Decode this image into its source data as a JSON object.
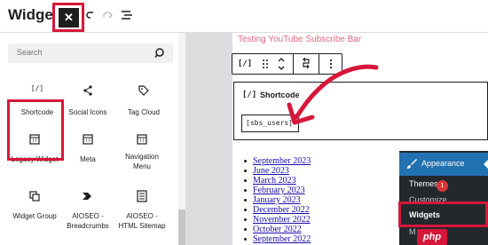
{
  "header": {
    "title": "Widgets",
    "close_glyph": "✕",
    "icons": [
      "close-icon",
      "undo-icon",
      "redo-icon",
      "list-view-icon"
    ]
  },
  "inserter": {
    "search_placeholder": "Search",
    "blocks": [
      {
        "label": "Shortcode",
        "icon": "shortcode-icon",
        "glyph": "[/]"
      },
      {
        "label": "Social Icons",
        "icon": "share-icon"
      },
      {
        "label": "Tag Cloud",
        "icon": "tag-icon"
      },
      {
        "label": "Legacy Widget",
        "icon": "calendar-icon"
      },
      {
        "label": "Meta",
        "icon": "calendar-icon"
      },
      {
        "label": "Navigation Menu",
        "icon": "calendar-icon"
      },
      {
        "label": "Widget Group",
        "icon": "group-icon"
      },
      {
        "label": "AIOSEO - Breadcrumbs",
        "icon": "aioseo-breadcrumbs-icon"
      },
      {
        "label": "AIOSEO - HTML Sitemap",
        "icon": "aioseo-sitemap-icon"
      }
    ]
  },
  "editor": {
    "widget_title": "Testing YouTube Subscribe Bar",
    "toolbar": {
      "shortcode_glyph": "[/]",
      "icons": [
        "shortcode-icon",
        "drag-handle-icon",
        "move-arrows-icon",
        "transform-icon",
        "more-options-icon"
      ]
    },
    "shortcode_block": {
      "icon_glyph": "[/]",
      "label": "Shortcode",
      "value": "[sbs_users]"
    },
    "archives": [
      "September 2023",
      "June 2023",
      "March 2023",
      "February 2023",
      "January 2023",
      "December 2022",
      "November 2022",
      "October 2022",
      "September 2022"
    ]
  },
  "admin_menu": {
    "section": "Appearance",
    "items": [
      "Themes",
      "Customize",
      "Widgets",
      "M"
    ],
    "themes_badge": "1"
  },
  "watermark": "php",
  "colors": {
    "highlight": "#d6173a",
    "admin_bg": "#23282d",
    "admin_active": "#2271b1",
    "link": "#1a0dab",
    "title_pink": "#e2687c"
  }
}
